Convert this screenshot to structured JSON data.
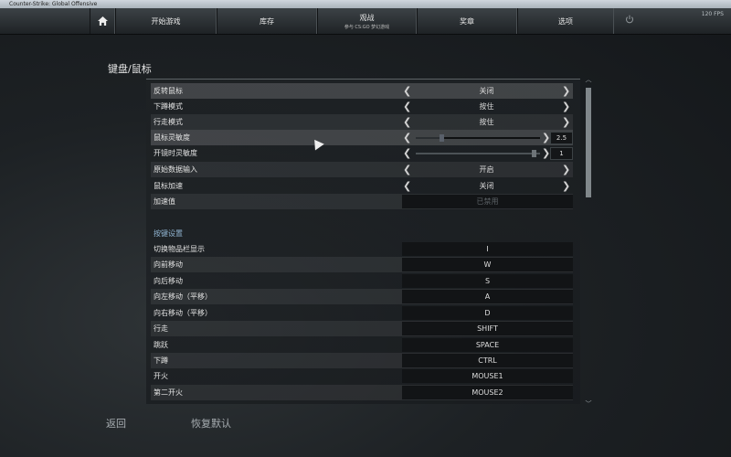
{
  "window": {
    "title": "Counter-Strike: Global Offensive"
  },
  "nav": {
    "play": "开始游戏",
    "inventory": "库存",
    "watch": "观战",
    "watch_sub": "参与 CS:GO 梦幻游戏",
    "awards": "奖章",
    "options": "选项",
    "fps": "120 FPS"
  },
  "section_title": "键盘/鼠标",
  "settings": [
    {
      "label": "反转鼠标",
      "value": "关闭"
    },
    {
      "label": "下蹲模式",
      "value": "按住"
    },
    {
      "label": "行走模式",
      "value": "按住"
    },
    {
      "label": "鼠标灵敏度",
      "value": "2.5"
    },
    {
      "label": "开镜时灵敏度",
      "value": "1"
    },
    {
      "label": "原始数据输入",
      "value": "开启"
    },
    {
      "label": "鼠标加速",
      "value": "关闭"
    },
    {
      "label": "加速值",
      "value": "已禁用"
    }
  ],
  "keys_header": "按键设置",
  "keys": [
    {
      "label": "切换物品栏显示",
      "key": "I"
    },
    {
      "label": "向前移动",
      "key": "W"
    },
    {
      "label": "向后移动",
      "key": "S"
    },
    {
      "label": "向左移动（平移）",
      "key": "A"
    },
    {
      "label": "向右移动（平移）",
      "key": "D"
    },
    {
      "label": "行走",
      "key": "SHIFT"
    },
    {
      "label": "跳跃",
      "key": "SPACE"
    },
    {
      "label": "下蹲",
      "key": "CTRL"
    },
    {
      "label": "开火",
      "key": "MOUSE1"
    },
    {
      "label": "第二开火",
      "key": "MOUSE2"
    }
  ],
  "sliders": {
    "mouse_sensitivity_fraction": 0.2,
    "zoom_sensitivity_fraction": 0.97
  },
  "footer": {
    "back": "返回",
    "reset": "恢复默认"
  },
  "colors": {
    "accent": "#8fb3d0"
  }
}
